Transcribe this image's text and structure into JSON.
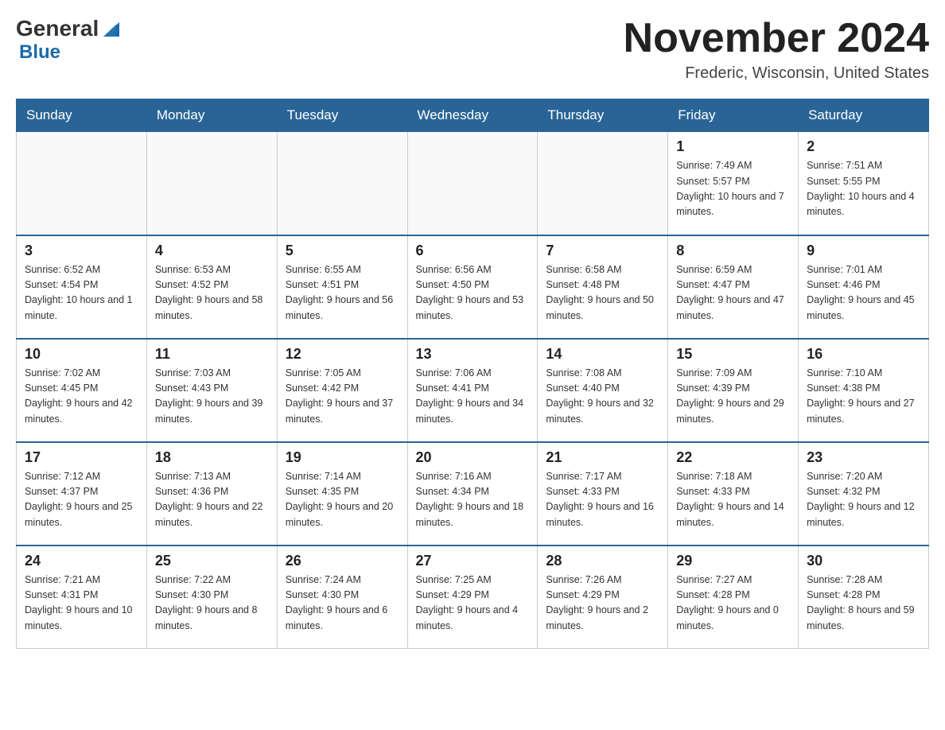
{
  "header": {
    "logo_general": "General",
    "logo_blue": "Blue",
    "month_year": "November 2024",
    "location": "Frederic, Wisconsin, United States"
  },
  "weekdays": [
    "Sunday",
    "Monday",
    "Tuesday",
    "Wednesday",
    "Thursday",
    "Friday",
    "Saturday"
  ],
  "weeks": [
    {
      "days": [
        {
          "number": "",
          "sunrise": "",
          "sunset": "",
          "daylight": ""
        },
        {
          "number": "",
          "sunrise": "",
          "sunset": "",
          "daylight": ""
        },
        {
          "number": "",
          "sunrise": "",
          "sunset": "",
          "daylight": ""
        },
        {
          "number": "",
          "sunrise": "",
          "sunset": "",
          "daylight": ""
        },
        {
          "number": "",
          "sunrise": "",
          "sunset": "",
          "daylight": ""
        },
        {
          "number": "1",
          "sunrise": "Sunrise: 7:49 AM",
          "sunset": "Sunset: 5:57 PM",
          "daylight": "Daylight: 10 hours and 7 minutes."
        },
        {
          "number": "2",
          "sunrise": "Sunrise: 7:51 AM",
          "sunset": "Sunset: 5:55 PM",
          "daylight": "Daylight: 10 hours and 4 minutes."
        }
      ]
    },
    {
      "days": [
        {
          "number": "3",
          "sunrise": "Sunrise: 6:52 AM",
          "sunset": "Sunset: 4:54 PM",
          "daylight": "Daylight: 10 hours and 1 minute."
        },
        {
          "number": "4",
          "sunrise": "Sunrise: 6:53 AM",
          "sunset": "Sunset: 4:52 PM",
          "daylight": "Daylight: 9 hours and 58 minutes."
        },
        {
          "number": "5",
          "sunrise": "Sunrise: 6:55 AM",
          "sunset": "Sunset: 4:51 PM",
          "daylight": "Daylight: 9 hours and 56 minutes."
        },
        {
          "number": "6",
          "sunrise": "Sunrise: 6:56 AM",
          "sunset": "Sunset: 4:50 PM",
          "daylight": "Daylight: 9 hours and 53 minutes."
        },
        {
          "number": "7",
          "sunrise": "Sunrise: 6:58 AM",
          "sunset": "Sunset: 4:48 PM",
          "daylight": "Daylight: 9 hours and 50 minutes."
        },
        {
          "number": "8",
          "sunrise": "Sunrise: 6:59 AM",
          "sunset": "Sunset: 4:47 PM",
          "daylight": "Daylight: 9 hours and 47 minutes."
        },
        {
          "number": "9",
          "sunrise": "Sunrise: 7:01 AM",
          "sunset": "Sunset: 4:46 PM",
          "daylight": "Daylight: 9 hours and 45 minutes."
        }
      ]
    },
    {
      "days": [
        {
          "number": "10",
          "sunrise": "Sunrise: 7:02 AM",
          "sunset": "Sunset: 4:45 PM",
          "daylight": "Daylight: 9 hours and 42 minutes."
        },
        {
          "number": "11",
          "sunrise": "Sunrise: 7:03 AM",
          "sunset": "Sunset: 4:43 PM",
          "daylight": "Daylight: 9 hours and 39 minutes."
        },
        {
          "number": "12",
          "sunrise": "Sunrise: 7:05 AM",
          "sunset": "Sunset: 4:42 PM",
          "daylight": "Daylight: 9 hours and 37 minutes."
        },
        {
          "number": "13",
          "sunrise": "Sunrise: 7:06 AM",
          "sunset": "Sunset: 4:41 PM",
          "daylight": "Daylight: 9 hours and 34 minutes."
        },
        {
          "number": "14",
          "sunrise": "Sunrise: 7:08 AM",
          "sunset": "Sunset: 4:40 PM",
          "daylight": "Daylight: 9 hours and 32 minutes."
        },
        {
          "number": "15",
          "sunrise": "Sunrise: 7:09 AM",
          "sunset": "Sunset: 4:39 PM",
          "daylight": "Daylight: 9 hours and 29 minutes."
        },
        {
          "number": "16",
          "sunrise": "Sunrise: 7:10 AM",
          "sunset": "Sunset: 4:38 PM",
          "daylight": "Daylight: 9 hours and 27 minutes."
        }
      ]
    },
    {
      "days": [
        {
          "number": "17",
          "sunrise": "Sunrise: 7:12 AM",
          "sunset": "Sunset: 4:37 PM",
          "daylight": "Daylight: 9 hours and 25 minutes."
        },
        {
          "number": "18",
          "sunrise": "Sunrise: 7:13 AM",
          "sunset": "Sunset: 4:36 PM",
          "daylight": "Daylight: 9 hours and 22 minutes."
        },
        {
          "number": "19",
          "sunrise": "Sunrise: 7:14 AM",
          "sunset": "Sunset: 4:35 PM",
          "daylight": "Daylight: 9 hours and 20 minutes."
        },
        {
          "number": "20",
          "sunrise": "Sunrise: 7:16 AM",
          "sunset": "Sunset: 4:34 PM",
          "daylight": "Daylight: 9 hours and 18 minutes."
        },
        {
          "number": "21",
          "sunrise": "Sunrise: 7:17 AM",
          "sunset": "Sunset: 4:33 PM",
          "daylight": "Daylight: 9 hours and 16 minutes."
        },
        {
          "number": "22",
          "sunrise": "Sunrise: 7:18 AM",
          "sunset": "Sunset: 4:33 PM",
          "daylight": "Daylight: 9 hours and 14 minutes."
        },
        {
          "number": "23",
          "sunrise": "Sunrise: 7:20 AM",
          "sunset": "Sunset: 4:32 PM",
          "daylight": "Daylight: 9 hours and 12 minutes."
        }
      ]
    },
    {
      "days": [
        {
          "number": "24",
          "sunrise": "Sunrise: 7:21 AM",
          "sunset": "Sunset: 4:31 PM",
          "daylight": "Daylight: 9 hours and 10 minutes."
        },
        {
          "number": "25",
          "sunrise": "Sunrise: 7:22 AM",
          "sunset": "Sunset: 4:30 PM",
          "daylight": "Daylight: 9 hours and 8 minutes."
        },
        {
          "number": "26",
          "sunrise": "Sunrise: 7:24 AM",
          "sunset": "Sunset: 4:30 PM",
          "daylight": "Daylight: 9 hours and 6 minutes."
        },
        {
          "number": "27",
          "sunrise": "Sunrise: 7:25 AM",
          "sunset": "Sunset: 4:29 PM",
          "daylight": "Daylight: 9 hours and 4 minutes."
        },
        {
          "number": "28",
          "sunrise": "Sunrise: 7:26 AM",
          "sunset": "Sunset: 4:29 PM",
          "daylight": "Daylight: 9 hours and 2 minutes."
        },
        {
          "number": "29",
          "sunrise": "Sunrise: 7:27 AM",
          "sunset": "Sunset: 4:28 PM",
          "daylight": "Daylight: 9 hours and 0 minutes."
        },
        {
          "number": "30",
          "sunrise": "Sunrise: 7:28 AM",
          "sunset": "Sunset: 4:28 PM",
          "daylight": "Daylight: 8 hours and 59 minutes."
        }
      ]
    }
  ]
}
